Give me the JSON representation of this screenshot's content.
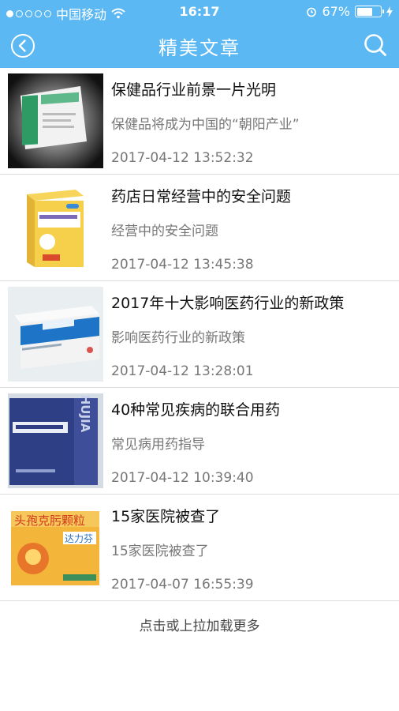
{
  "status": {
    "carrier": "中国移动",
    "time": "16:17",
    "battery": "67%",
    "battery_level": 0.67
  },
  "header": {
    "title": "精美文章"
  },
  "articles": [
    {
      "title": "保健品行业前景一片光明",
      "summary": "保健品将成为中国的“朝阳产业”",
      "date": "2017-04-12 13:52:32"
    },
    {
      "title": "药店日常经营中的安全问题",
      "summary": "经营中的安全问题",
      "date": "2017-04-12 13:45:38"
    },
    {
      "title": "2017年十大影响医药行业的新政策",
      "summary": "影响医药行业的新政策",
      "date": "2017-04-12 13:28:01"
    },
    {
      "title": "40种常见疾病的联合用药",
      "summary": "常见病用药指导",
      "date": "2017-04-12 10:39:40"
    },
    {
      "title": "15家医院被查了",
      "summary": "15家医院被查了",
      "date": "2017-04-07 16:55:39"
    }
  ],
  "thumb_labels": [
    "CHUJIA",
    "头孢克肟颗粒",
    "达力芬"
  ],
  "load_more": "点击或上拉加载更多",
  "colors": {
    "header": "#5bb8f3",
    "divider": "#dcdcdc"
  }
}
